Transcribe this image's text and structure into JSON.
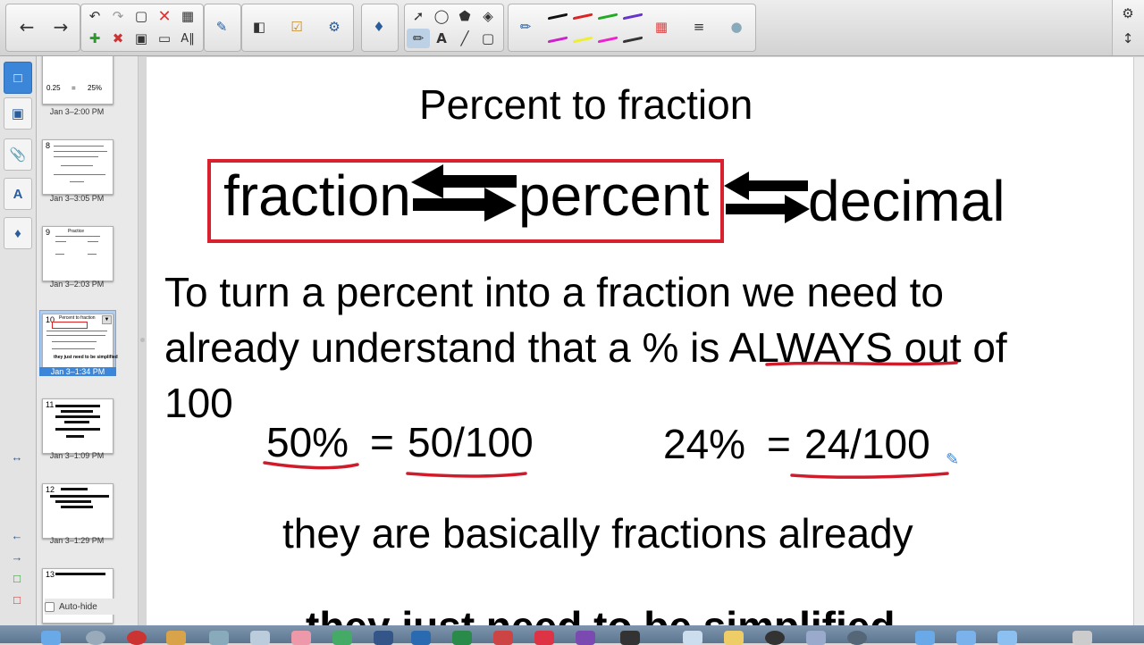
{
  "toolbar": {
    "groups": [
      "navigation",
      "edit",
      "view",
      "insert",
      "drawing",
      "pens",
      "properties"
    ]
  },
  "side_tabs": [
    "page-sorter",
    "gallery",
    "attachments",
    "properties",
    "add-ons"
  ],
  "slides": [
    {
      "num": "",
      "time": "Jan 3–2:00 PM",
      "mini": [
        "0.25",
        "=",
        "25%"
      ]
    },
    {
      "num": "8",
      "time": "Jan 3–3:05 PM"
    },
    {
      "num": "9",
      "time": "Jan 3–2:03 PM",
      "mini": [
        "Practice"
      ]
    },
    {
      "num": "10",
      "time": "Jan 3–1:34 PM",
      "mini": [
        "Percent to fraction",
        "they just need to be simplified"
      ]
    },
    {
      "num": "11",
      "time": "Jan 3–1:09 PM"
    },
    {
      "num": "12",
      "time": "Jan 3–1:29 PM"
    },
    {
      "num": "13",
      "time": ""
    }
  ],
  "autohide_label": "Auto-hide",
  "canvas": {
    "title": "Percent to fraction",
    "word_fraction": "fraction",
    "word_percent": "percent",
    "word_decimal": "decimal",
    "line1": "To turn a percent into a fraction we need to",
    "line2_pre": "already understand that a % is ",
    "line2_em": "ALWAYS",
    "line2_post": " out of",
    "line3": "100",
    "ex1_left": "50%",
    "ex1_eq": "=",
    "ex1_right": "50/100",
    "ex2_left": "24%",
    "ex2_eq": "=",
    "ex2_right": "24/100",
    "line4": "they are basically fractions already",
    "line5": "they just need to be simplified"
  },
  "colors": {
    "ink_red": "#d11a2a",
    "box_red": "#d8202e",
    "accent_blue": "#3b86d8"
  }
}
